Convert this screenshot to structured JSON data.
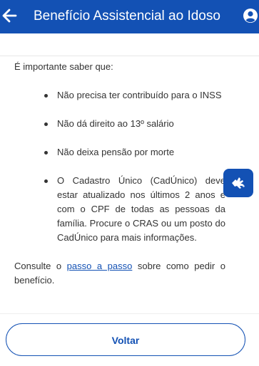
{
  "header": {
    "title": "Benefício Assistencial ao Idoso",
    "back_icon": "arrow-left-icon",
    "user_icon": "user-circle-icon"
  },
  "content": {
    "intro": "É importante saber que:",
    "bullets": [
      "Não precisa ter contribuído para o INSS",
      "Não dá direito ao 13º salário",
      "Não deixa pensão por morte",
      "O Cadastro Único (CadÚnico) deve estar atualizado nos últimos 2 anos e com o CPF de todas as pessoas da família. Procure o CRAS ou um posto do CadÚnico para mais informações."
    ],
    "consult_prefix": "Consulte o",
    "consult_link": "passo a passo",
    "consult_suffix": "sobre como pedir o benefício."
  },
  "accessibility": {
    "icon": "hand-sign-language-icon"
  },
  "footer": {
    "back_label": "Voltar"
  },
  "colors": {
    "primary": "#1351b4",
    "text": "#333333",
    "background": "#ffffff"
  }
}
